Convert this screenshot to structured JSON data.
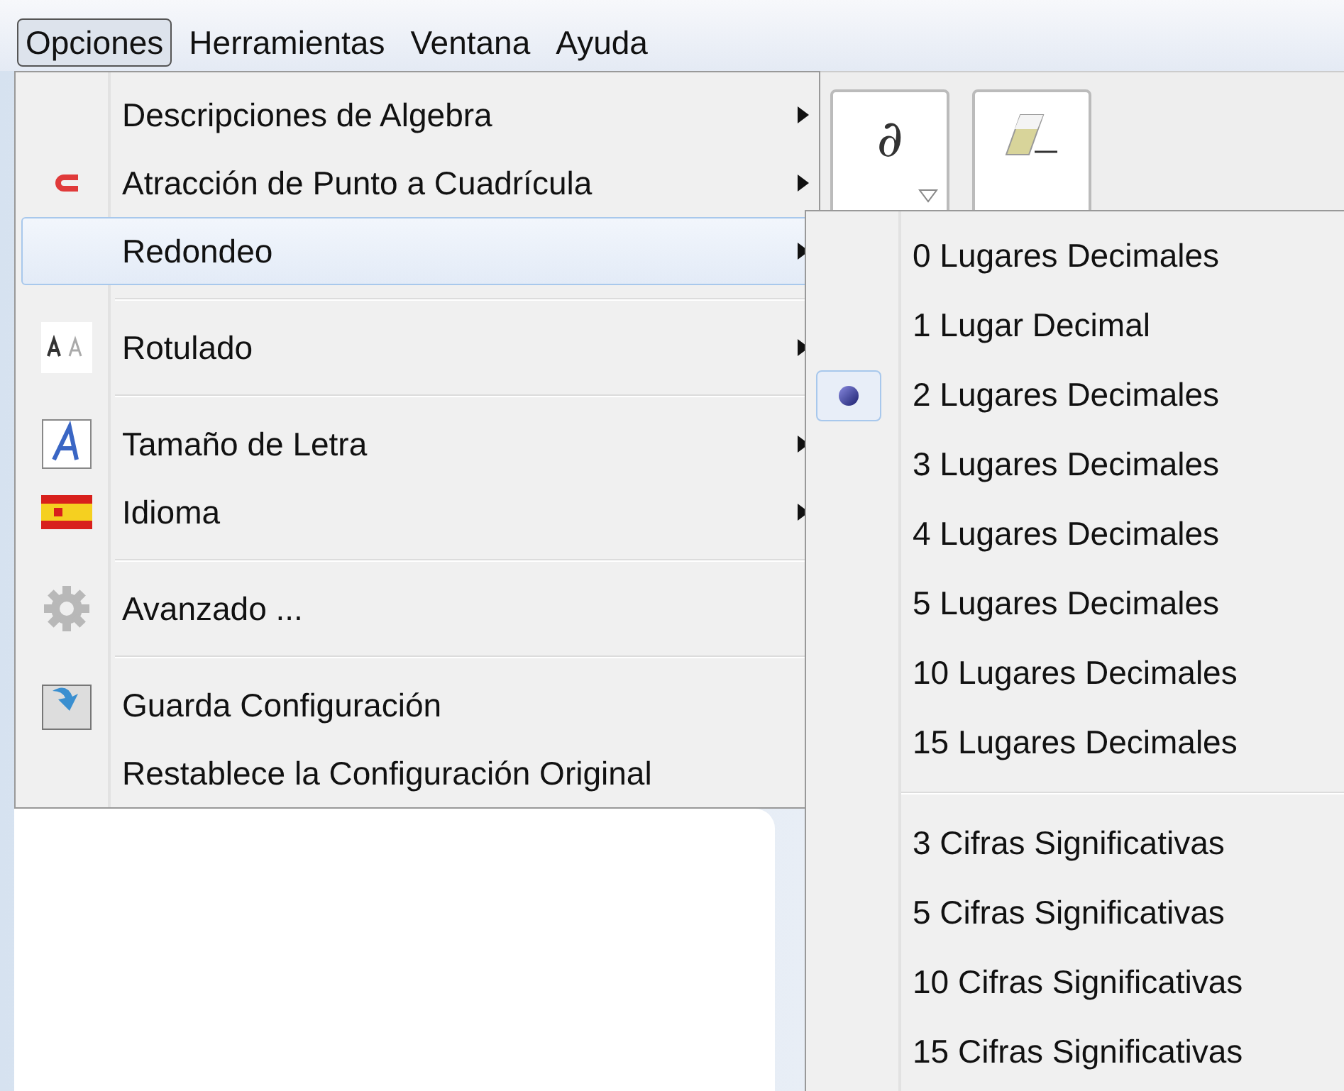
{
  "menubar": [
    {
      "label": "Opciones",
      "selected": true
    },
    {
      "label": "Herramientas",
      "selected": false
    },
    {
      "label": "Ventana",
      "selected": false
    },
    {
      "label": "Ayuda",
      "selected": false
    }
  ],
  "toolbar": [
    {
      "kind": "symbol",
      "symbol": "∂",
      "dropdown": true
    },
    {
      "kind": "eraser",
      "dropdown": false
    }
  ],
  "menu": [
    {
      "kind": "item",
      "label": "Descripciones de Algebra",
      "submenu": true,
      "highlighted": false
    },
    {
      "kind": "item",
      "label": "Atracción de Punto a Cuadrícula",
      "submenu": true,
      "highlighted": false
    },
    {
      "kind": "item",
      "label": "Redondeo",
      "submenu": true,
      "highlighted": true
    },
    {
      "kind": "separator"
    },
    {
      "kind": "item",
      "label": "Rotulado",
      "submenu": true,
      "highlighted": false
    },
    {
      "kind": "separator"
    },
    {
      "kind": "item",
      "label": "Tamaño de Letra",
      "submenu": true,
      "highlighted": false
    },
    {
      "kind": "item",
      "label": "Idioma",
      "submenu": true,
      "highlighted": false
    },
    {
      "kind": "separator"
    },
    {
      "kind": "item",
      "label": "Avanzado ...",
      "submenu": false,
      "highlighted": false
    },
    {
      "kind": "separator"
    },
    {
      "kind": "item",
      "label": "Guarda Configuración",
      "submenu": false,
      "highlighted": false
    },
    {
      "kind": "item",
      "label": "Restablece la Configuración Original",
      "submenu": false,
      "highlighted": false
    }
  ],
  "submenu": [
    {
      "kind": "radio",
      "label": "0 Lugares Decimales",
      "selected": false
    },
    {
      "kind": "radio",
      "label": "1 Lugar Decimal",
      "selected": false
    },
    {
      "kind": "radio",
      "label": "2 Lugares Decimales",
      "selected": true
    },
    {
      "kind": "radio",
      "label": "3 Lugares Decimales",
      "selected": false
    },
    {
      "kind": "radio",
      "label": "4 Lugares Decimales",
      "selected": false
    },
    {
      "kind": "radio",
      "label": "5 Lugares Decimales",
      "selected": false
    },
    {
      "kind": "radio",
      "label": "10 Lugares Decimales",
      "selected": false
    },
    {
      "kind": "radio",
      "label": "15 Lugares Decimales",
      "selected": false
    },
    {
      "kind": "separator"
    },
    {
      "kind": "radio",
      "label": "3 Cifras Significativas",
      "selected": false
    },
    {
      "kind": "radio",
      "label": "5 Cifras Significativas",
      "selected": false
    },
    {
      "kind": "radio",
      "label": "10 Cifras Significativas",
      "selected": false
    },
    {
      "kind": "radio",
      "label": "15 Cifras Significativas",
      "selected": false
    }
  ]
}
